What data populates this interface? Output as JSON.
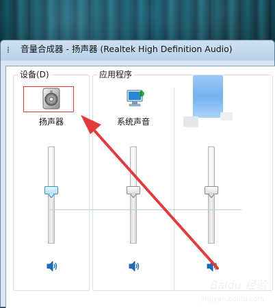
{
  "window": {
    "title": "音量合成器 - 扬声器 (Realtek High Definition Audio)"
  },
  "groups": {
    "device_label": "设备(D)",
    "apps_label": "应用程序"
  },
  "channels": [
    {
      "name": "扬声器",
      "icon": "speaker-icon",
      "volume": 0.55,
      "mute_icon": "speaker-volume-icon"
    },
    {
      "name": "系统声音",
      "icon": "system-sounds-icon",
      "volume": 0.55,
      "mute_icon": "speaker-volume-icon"
    },
    {
      "name": "",
      "icon": "app-icon",
      "volume": 0.55,
      "mute_icon": "speaker-volume-icon"
    }
  ],
  "annotation": {
    "highlight_color": "#e23a3a",
    "arrow_color": "#e33b3b"
  },
  "watermark": {
    "text": "Baidu 经验",
    "sub": "jingyan.baidu.com"
  }
}
